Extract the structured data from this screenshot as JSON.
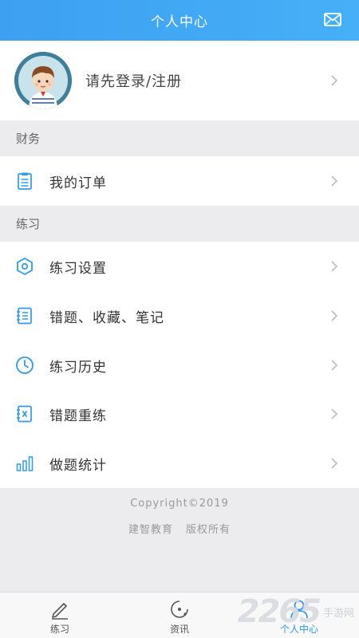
{
  "header": {
    "title": "个人中心",
    "mail_icon": "mail-icon"
  },
  "profile": {
    "login_text": "请先登录/注册",
    "avatar_icon": "avatar-boy"
  },
  "sections": {
    "finance": {
      "title": "财务"
    },
    "practice": {
      "title": "练习"
    }
  },
  "finance_items": [
    {
      "label": "我的订单",
      "icon": "clipboard-icon"
    }
  ],
  "practice_items": [
    {
      "label": "练习设置",
      "icon": "hexagon-settings-icon"
    },
    {
      "label": "错题、收藏、笔记",
      "icon": "notebook-list-icon"
    },
    {
      "label": "练习历史",
      "icon": "clock-icon"
    },
    {
      "label": "错题重练",
      "icon": "wrong-book-icon"
    },
    {
      "label": "做题统计",
      "icon": "bar-stats-icon"
    }
  ],
  "footer": {
    "copyright": "Copyright©2019",
    "company": "建智教育",
    "rights": "版权所有"
  },
  "tabs": [
    {
      "label": "练习",
      "icon": "pencil-icon",
      "active": false
    },
    {
      "label": "资讯",
      "icon": "news-icon",
      "active": false
    },
    {
      "label": "个人中心",
      "icon": "user-icon",
      "active": true
    }
  ],
  "watermark": {
    "number": "2265",
    "text": "手游网"
  },
  "colors": {
    "accent": "#2d9af0",
    "header_start": "#3da0f2",
    "header_end": "#45b0f7",
    "background": "#ececee"
  }
}
